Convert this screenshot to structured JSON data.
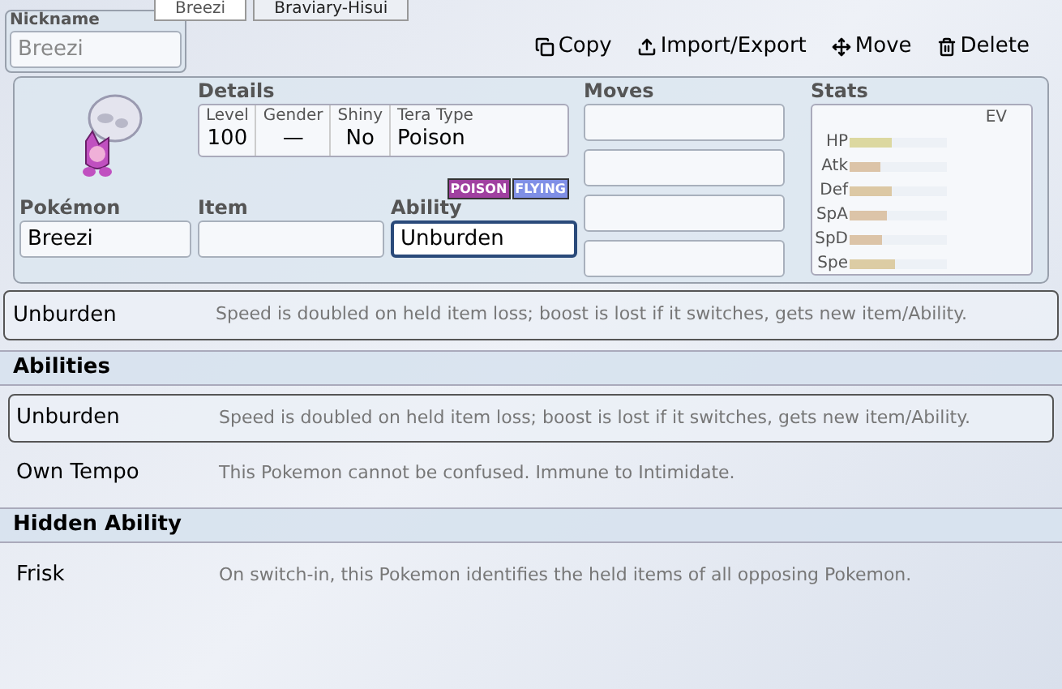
{
  "tabs": [
    {
      "label": "Breezi",
      "selected": true
    },
    {
      "label": "Braviary-Hisui",
      "selected": false
    }
  ],
  "nickname": {
    "label": "Nickname",
    "placeholder": "Breezi"
  },
  "actions": [
    {
      "kind": "copy",
      "label": "Copy"
    },
    {
      "kind": "import",
      "label": "Import/Export"
    },
    {
      "kind": "move",
      "label": "Move"
    },
    {
      "kind": "delete",
      "label": "Delete"
    }
  ],
  "details": {
    "title": "Details",
    "fields": [
      {
        "label": "Level",
        "value": "100"
      },
      {
        "label": "Gender",
        "value": "—"
      },
      {
        "label": "Shiny",
        "value": "No"
      },
      {
        "label": "Tera Type",
        "value": "Poison"
      }
    ]
  },
  "types": [
    {
      "label": "POISON",
      "color": "#a040a0"
    },
    {
      "label": "FLYING",
      "color": "#7f8fe6"
    }
  ],
  "inputs": [
    {
      "label": "Pokémon",
      "value": "Breezi",
      "focused": false
    },
    {
      "label": "Item",
      "focused": false
    },
    {
      "label": "Ability",
      "value": "Unburden",
      "focused": true
    }
  ],
  "moves": {
    "title": "Moves",
    "fields": [
      {
        "focused": false
      },
      {
        "focused": false
      },
      {
        "focused": false
      },
      {
        "focused": false
      }
    ]
  },
  "stats": {
    "title": "Stats",
    "column": "EV",
    "rows": [
      {
        "label": "HP",
        "level": 0.43,
        "color": "#dcd8a0"
      },
      {
        "label": "Atk",
        "level": 0.32,
        "color": "#dcc4a8"
      },
      {
        "label": "Def",
        "level": 0.43,
        "color": "#dcc8a4"
      },
      {
        "label": "SpA",
        "level": 0.38,
        "color": "#dcc4a8"
      },
      {
        "label": "SpD",
        "level": 0.33,
        "color": "#dcc4a8"
      },
      {
        "label": "Spe",
        "level": 0.47,
        "color": "#dccca4"
      }
    ]
  },
  "current": {
    "name": "Unburden",
    "description": "Speed is doubled on held item loss; boost is lost if it switches, gets new item/Ability."
  },
  "sections": [
    {
      "title": "Abilities",
      "rows": [
        {
          "name": "Unburden",
          "description": "Speed is doubled on held item loss; boost is lost if it switches, gets new item/Ability.",
          "selected": true
        },
        {
          "name": "Own Tempo",
          "description": "This Pokemon cannot be confused. Immune to Intimidate.",
          "selected": false
        }
      ]
    },
    {
      "title": "Hidden Ability",
      "rows": [
        {
          "name": "Frisk",
          "description": "On switch-in, this Pokemon identifies the held items of all opposing Pokemon.",
          "selected": false
        }
      ]
    }
  ]
}
